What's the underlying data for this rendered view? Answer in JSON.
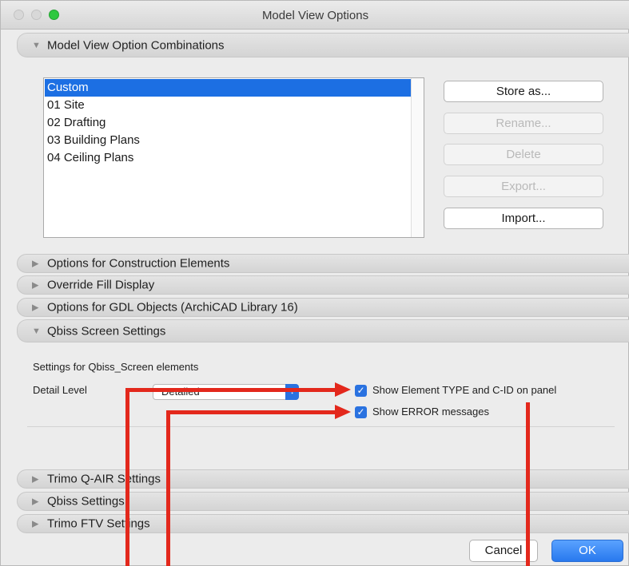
{
  "window": {
    "title": "Model View Options"
  },
  "sections": {
    "combinations": "Model View Option Combinations",
    "construction": "Options for Construction Elements",
    "override_fill": "Override Fill Display",
    "gdl": "Options for GDL Objects (ArchiCAD Library 16)",
    "qbiss_screen": "Qbiss Screen Settings",
    "trimo_qair": "Trimo Q-AIR Settings",
    "qbiss": "Qbiss Settings",
    "trimo_ftv": "Trimo FTV Settings"
  },
  "combinations_list": {
    "selected": "Custom",
    "items": [
      "Custom",
      "01 Site",
      "02 Drafting",
      "03 Building Plans",
      "04 Ceiling Plans"
    ]
  },
  "combo_buttons": {
    "store_as": "Store as...",
    "rename": "Rename...",
    "delete": "Delete",
    "export": "Export...",
    "import": "Import..."
  },
  "qbiss_screen": {
    "settings_caption": "Settings for Qbiss_Screen elements",
    "detail_level_label": "Detail Level",
    "detail_level_value": "Detailed",
    "show_type_label": "Show Element TYPE and C-ID on panel",
    "show_type_checked": true,
    "show_errors_label": "Show ERROR messages",
    "show_errors_checked": true
  },
  "footer": {
    "cancel": "Cancel",
    "ok": "OK"
  },
  "colors": {
    "accent": "#2a72e0",
    "annotation": "#e3281c",
    "selection": "#1c6fe3"
  }
}
